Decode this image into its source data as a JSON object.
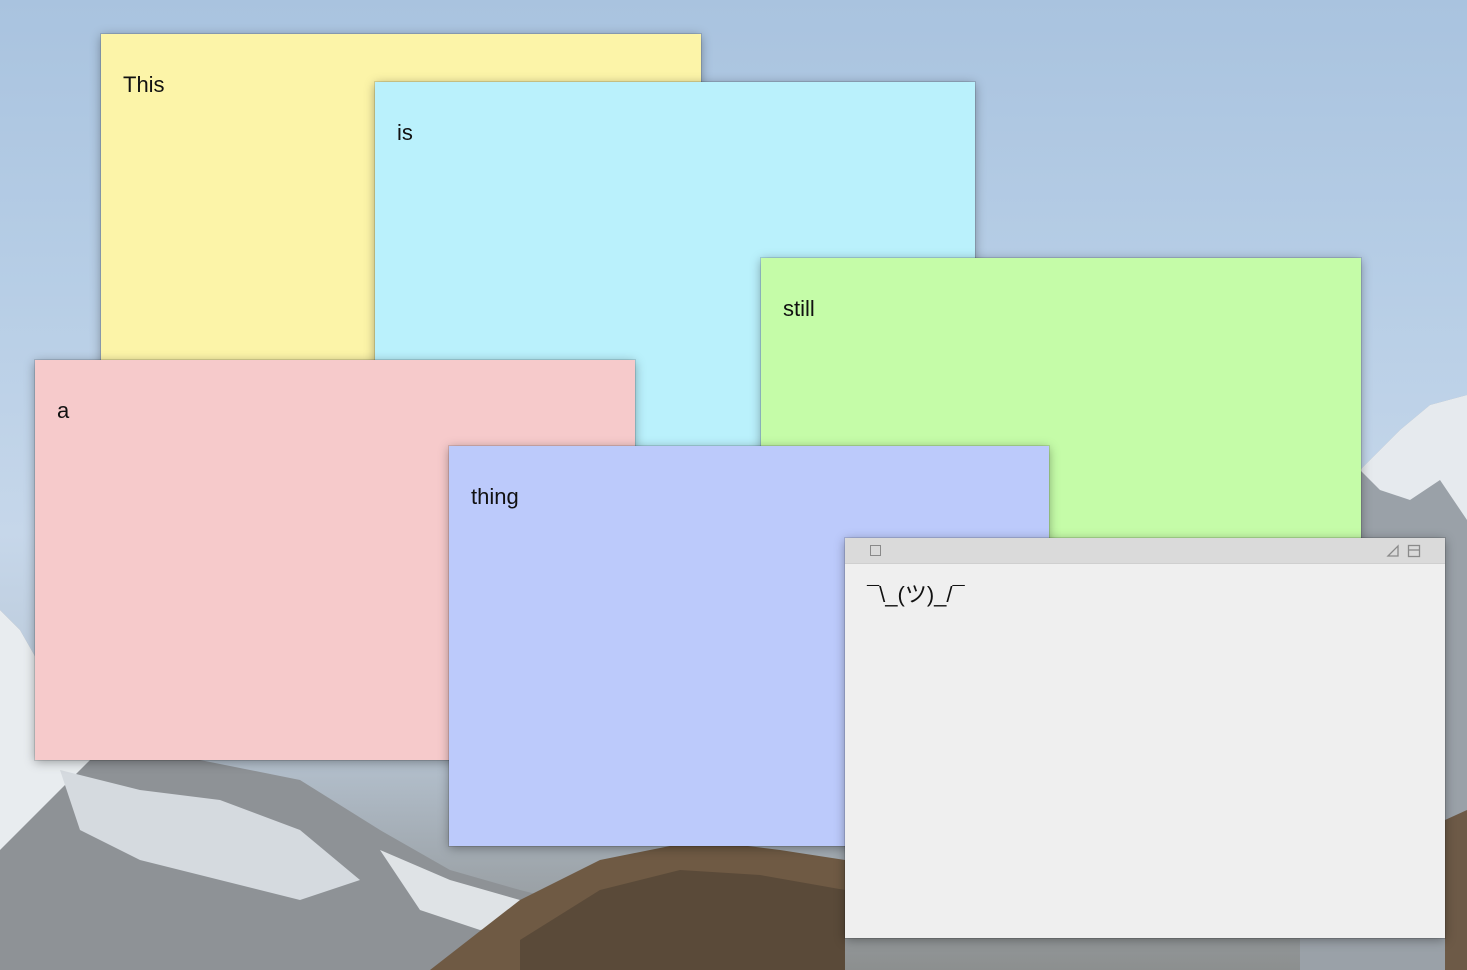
{
  "desktop": {
    "wallpaper": "mountain-landscape"
  },
  "notes": [
    {
      "text": "This",
      "color": "#fcf4a8"
    },
    {
      "text": "is",
      "color": "#baf1fc"
    },
    {
      "text": "still",
      "color": "#c5fca8"
    },
    {
      "text": "a",
      "color": "#f6cacb"
    },
    {
      "text": "thing",
      "color": "#bccafb"
    },
    {
      "text": "¯\\_(ツ)_/¯",
      "color": "#efefef"
    }
  ],
  "active_note": {
    "titlebar_icons": [
      "close-icon",
      "translucent-icon",
      "collapse-icon"
    ]
  }
}
